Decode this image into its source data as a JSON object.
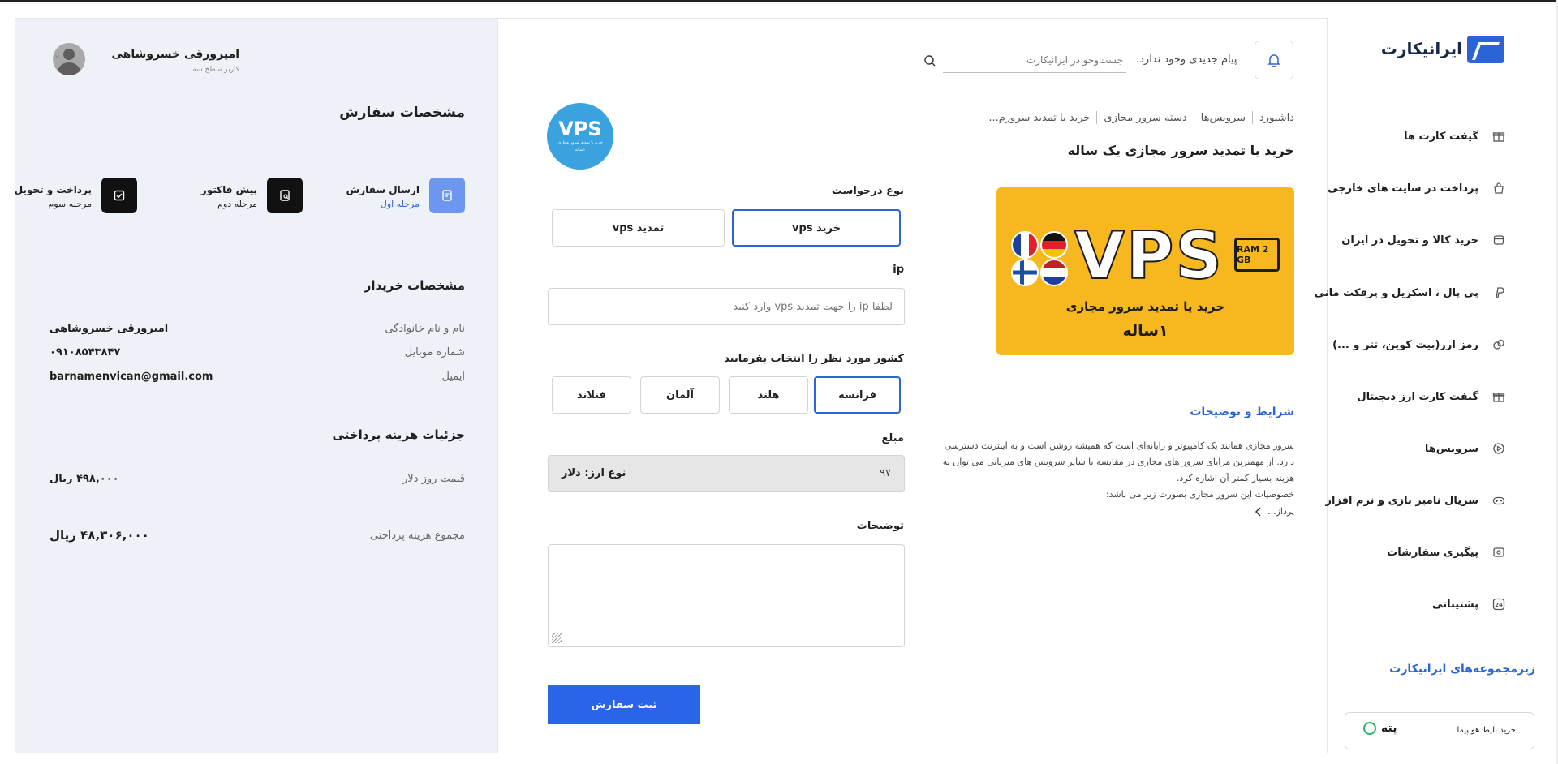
{
  "header": {
    "logo_text": "ایرانیکارت",
    "no_messages": "پیام جدیدی وجود ندارد.",
    "search_placeholder": "جست‌وجو در ایرانیکارت"
  },
  "breadcrumb": [
    "داشبورد",
    "سرویس‌ها",
    "دسته سرور مجازی",
    "خرید یا تمدید سرورم..."
  ],
  "page_title": "خرید یا تمدید سرور مجازی یک ساله",
  "banner": {
    "vps_text": "VPS",
    "ram_text": "RAM 2 GB",
    "line1": "خرید یا تمدید سرور مجازی",
    "line2": "۱ساله"
  },
  "vps_logo": {
    "title": "VPS",
    "subtitle": "خرید یا تمدید سرور مجازی",
    "subtitle2": "۱ساله"
  },
  "terms": {
    "title": "شرایط و توضیحات",
    "body": "سرور مجازی همانند یک کامپیوتر و رایانه‌ای است که همیشه روشن است و به اینترنت دسترسی دارد. از مهمترین مزایای سرور های مجازی در مقایسه با سایر سرویس های میزبانی می توان به هزینه بسیار کمتر آن اشاره کرد.",
    "line2": "خصوصیات این سرور مجازی بصورت زیر می باشد:",
    "more": "پرداز..."
  },
  "form": {
    "request_type_label": "نوع درخواست",
    "request_types": [
      "خرید vps",
      "تمدید vps"
    ],
    "ip_label": "ip",
    "ip_placeholder": "لطفا ip را جهت تمدید vps وارد کنید",
    "country_label": "کشور مورد نظر را انتخاب بفرمایید",
    "countries": [
      "فرانسه",
      "هلند",
      "آلمان",
      "فنلاند"
    ],
    "amount_label": "مبلغ",
    "amount_value": "۹۷",
    "currency": "نوع ارز: دلار",
    "description_label": "توضیحات",
    "submit": "ثبت سفارش"
  },
  "user": {
    "name": "امیرورقی خسروشاهی",
    "level": "کاربر سطح سه"
  },
  "order": {
    "title": "مشخصات سفارش",
    "steps": [
      {
        "title": "ارسال سفارش",
        "sub": "مرحله اول",
        "active": true
      },
      {
        "title": "پیش فاکتور",
        "sub": "مرحله دوم",
        "active": false
      },
      {
        "title": "پرداخت و تحویل",
        "sub": "مرحله سوم",
        "active": false
      }
    ],
    "buyer_title": "مشخصات خریدار",
    "buyer": [
      {
        "label": "نام و نام خانوادگی",
        "value": "امیرورقی خسروشاهی"
      },
      {
        "label": "شماره موبایل",
        "value": "۰۹۱۰۸۵۴۳۸۴۷"
      },
      {
        "label": "ایمیل",
        "value": "barnamenvican@gmail.com"
      }
    ],
    "payment_title": "جزئیات هزینه پرداختی",
    "dollar_label": "قیمت روز دلار",
    "dollar_value": "۴۹۸,۰۰۰ ریال",
    "total_label": "مجموع هزینه پرداختی",
    "total_value": "۴۸,۳۰۶,۰۰۰ ریال"
  },
  "sidebar": {
    "items": [
      {
        "label": "گیفت کارت ها",
        "icon": "gift-icon"
      },
      {
        "label": "پرداخت در سایت های خارجی",
        "icon": "bag-icon"
      },
      {
        "label": "خرید کالا و تحویل در ایران",
        "icon": "box-icon"
      },
      {
        "label": "پی پال ، اسکریل و پرفکت مانی",
        "icon": "paypal-icon"
      },
      {
        "label": "رمز ارز(بیت کوین، تتر و ...)",
        "icon": "crypto-icon"
      },
      {
        "label": "گیفت کارت ارز دیجیتال",
        "icon": "gift-icon"
      },
      {
        "label": "سرویس‌ها",
        "icon": "play-icon"
      },
      {
        "label": "سریال نامبر بازی و نرم افزار",
        "icon": "gamepad-icon"
      },
      {
        "label": "پیگیری سفارشات",
        "icon": "tracking-icon"
      },
      {
        "label": "پشتیبانی",
        "icon": "support-24-icon"
      }
    ],
    "subs_title": "زیرمجموعه‌های ایرانیکارت",
    "subs_card_text": "خرید بلیط هواپیما",
    "subs_card_brand": "پته"
  },
  "colors": {
    "accent": "#2a64e8",
    "panel": "#eef1f8",
    "banner": "#f6b81e",
    "logo_blue": "#3ba2e0"
  }
}
